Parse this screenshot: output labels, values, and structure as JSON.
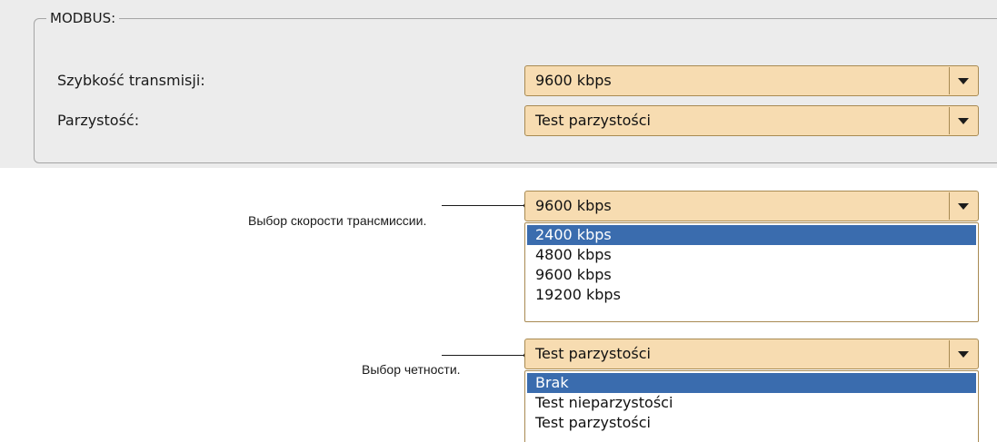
{
  "modbus_group": {
    "title": "MODBUS:",
    "baud_label": "Szybkość transmisji:",
    "baud_value": "9600 kbps",
    "parity_label": "Parzystość:",
    "parity_value": "Test parzystości"
  },
  "baud_dropdown": {
    "caption": "Выбор скорости трансмиссии.",
    "value": "9600 kbps",
    "options": [
      "2400 kbps",
      "4800 kbps",
      "9600 kbps",
      "19200 kbps"
    ],
    "highlighted_index": 0
  },
  "parity_dropdown": {
    "caption": "Выбор четности.",
    "value": "Test parzystości",
    "options": [
      "Brak",
      "Test nieparzystości",
      "Test parzystości"
    ],
    "highlighted_index": 0
  },
  "icons": {
    "combo_arrow": "chevron-down-icon"
  },
  "colors": {
    "combo_background": "#f7dcb1",
    "combo_border": "#a88a52",
    "highlight": "#3a6cae",
    "panel_background": "#ececec"
  }
}
